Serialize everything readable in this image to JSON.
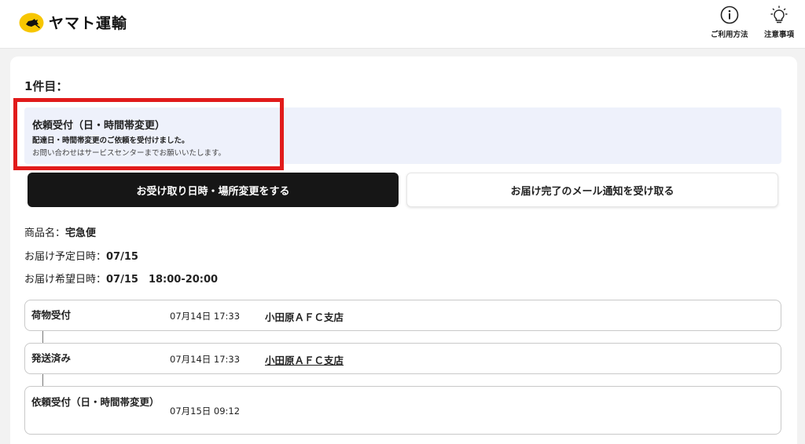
{
  "header": {
    "logo_text": "ヤマト運輸",
    "nav": [
      {
        "label": "ご利用方法",
        "icon": "info-circle-icon"
      },
      {
        "label": "注意事項",
        "icon": "lightbulb-icon"
      }
    ]
  },
  "item": {
    "number_label": "1件目："
  },
  "notice": {
    "title": "依頼受付（日・時間帯変更）",
    "line1": "配達日・時間帯変更のご依頼を受付けました。",
    "line2": "お問い合わせはサービスセンターまでお願いいたします。"
  },
  "actions": {
    "change_label": "お受け取り日時・場所変更をする",
    "notify_label": "お届け完了のメール通知を受け取る"
  },
  "details": {
    "product_label": "商品名：",
    "product_value": "宅急便",
    "scheduled_label": "お届け予定日時：",
    "scheduled_value": "07/15",
    "requested_label": "お届け希望日時：",
    "requested_value": "07/15　18:00-20:00"
  },
  "tracking": [
    {
      "status": "荷物受付",
      "date": "07月14日 17:33",
      "place": "小田原ＡＦＣ支店",
      "linked": false
    },
    {
      "status": "発送済み",
      "date": "07月14日 17:33",
      "place": "小田原ＡＦＣ支店",
      "linked": true
    },
    {
      "status": "依頼受付（日・時間帯変更）",
      "date": "07月15日 09:12",
      "place": "",
      "linked": false
    }
  ],
  "colors": {
    "brand_yellow": "#f7c600",
    "highlight_red": "#e11b1b",
    "notice_bg": "#eef1fb",
    "primary_button": "#161616"
  }
}
